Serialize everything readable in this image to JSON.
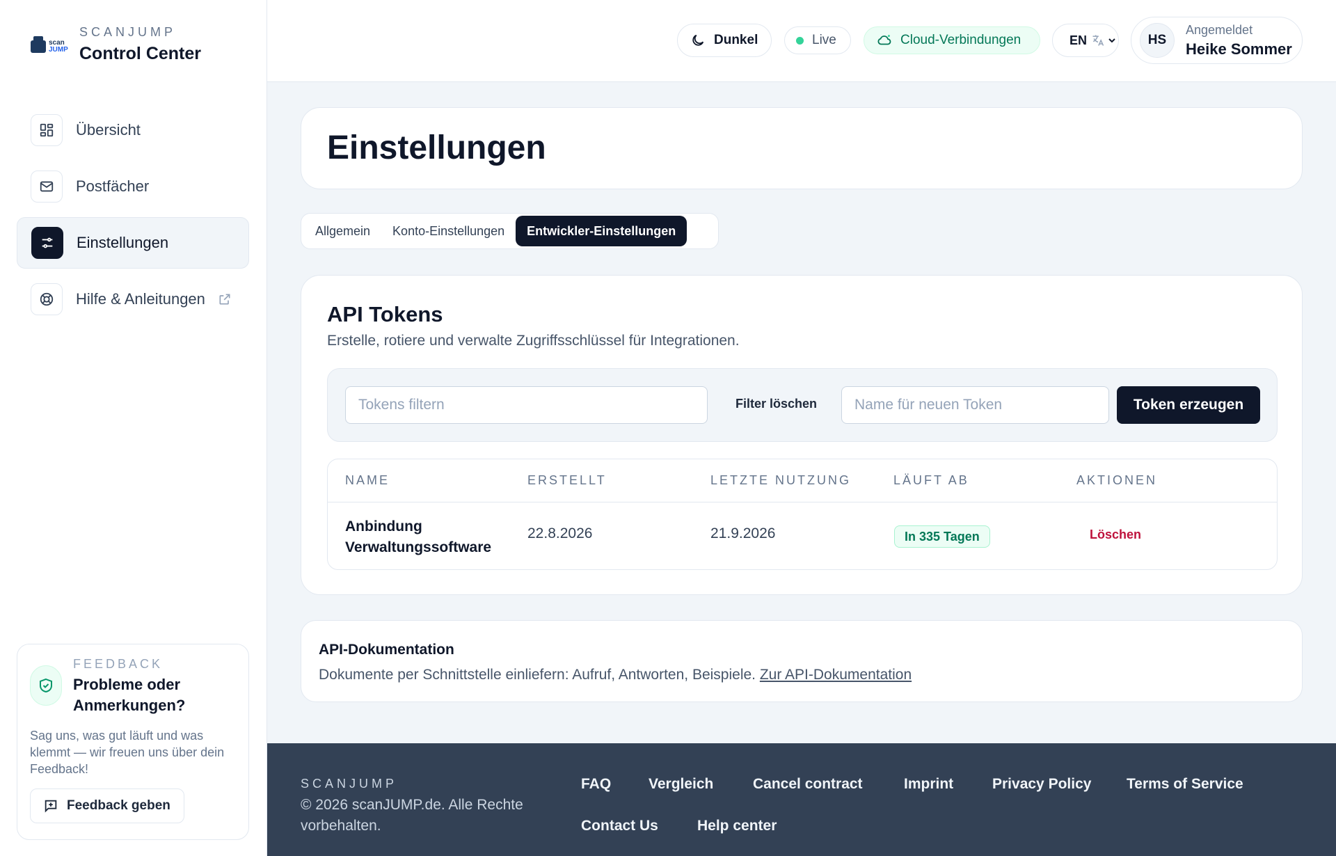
{
  "brand": {
    "logo_line1": "scan",
    "logo_line2": "JUMP",
    "kicker": "SCANJUMP",
    "name": "Control Center"
  },
  "nav": {
    "items": [
      {
        "label": "Übersicht",
        "icon": "dashboard-icon"
      },
      {
        "label": "Postfächer",
        "icon": "mail-icon"
      },
      {
        "label": "Einstellungen",
        "icon": "sliders-icon",
        "active": true
      },
      {
        "label": "Hilfe & Anleitungen",
        "icon": "lifebuoy-icon",
        "external": true
      }
    ]
  },
  "feedback": {
    "kicker": "FEEDBACK",
    "title": "Probleme oder Anmerkungen?",
    "description": "Sag uns, was gut läuft und was klemmt — wir freuen uns über dein Feedback!",
    "button": "Feedback geben"
  },
  "header": {
    "theme_toggle": "Dunkel",
    "status": "Live",
    "cloud": "Cloud-Verbindungen",
    "language": "EN",
    "user": {
      "initials": "HS",
      "label": "Angemeldet",
      "name": "Heike Sommer"
    }
  },
  "page": {
    "title": "Einstellungen"
  },
  "tabs": [
    {
      "label": "Allgemein"
    },
    {
      "label": "Konto-Einstellungen"
    },
    {
      "label": "Entwickler-Einstellungen",
      "active": true
    }
  ],
  "tokens": {
    "title": "API Tokens",
    "subtitle": "Erstelle, rotiere und verwalte Zugriffsschlüssel für Integrationen.",
    "filter_placeholder": "Tokens filtern",
    "clear_filter": "Filter löschen",
    "name_placeholder": "Name für neuen Token",
    "create_button": "Token erzeugen",
    "columns": [
      "NAME",
      "ERSTELLT",
      "LETZTE NUTZUNG",
      "LÄUFT AB",
      "AKTIONEN"
    ],
    "rows": [
      {
        "name": "Anbindung Verwaltungssoftware",
        "created": "22.8.2026",
        "last_used": "21.9.2026",
        "expires": "In 335 Tagen",
        "action": "Löschen"
      }
    ]
  },
  "docs": {
    "title": "API-Dokumentation",
    "text": "Dokumente per Schnittstelle einliefern: Aufruf, Antworten, Beispiele.",
    "link": "Zur API-Dokumentation"
  },
  "footer": {
    "kicker": "SCANJUMP",
    "copyright": "© 2026 scanJUMP.de. Alle Rechte vorbehalten.",
    "links": [
      "FAQ",
      "Vergleich",
      "Cancel contract",
      "Imprint",
      "Privacy Policy",
      "Terms of Service",
      "Contact Us",
      "Help center"
    ]
  },
  "colors": {
    "primary": "#0f172a",
    "success": "#047857",
    "danger": "#be123c",
    "footer_bg": "#334155"
  }
}
